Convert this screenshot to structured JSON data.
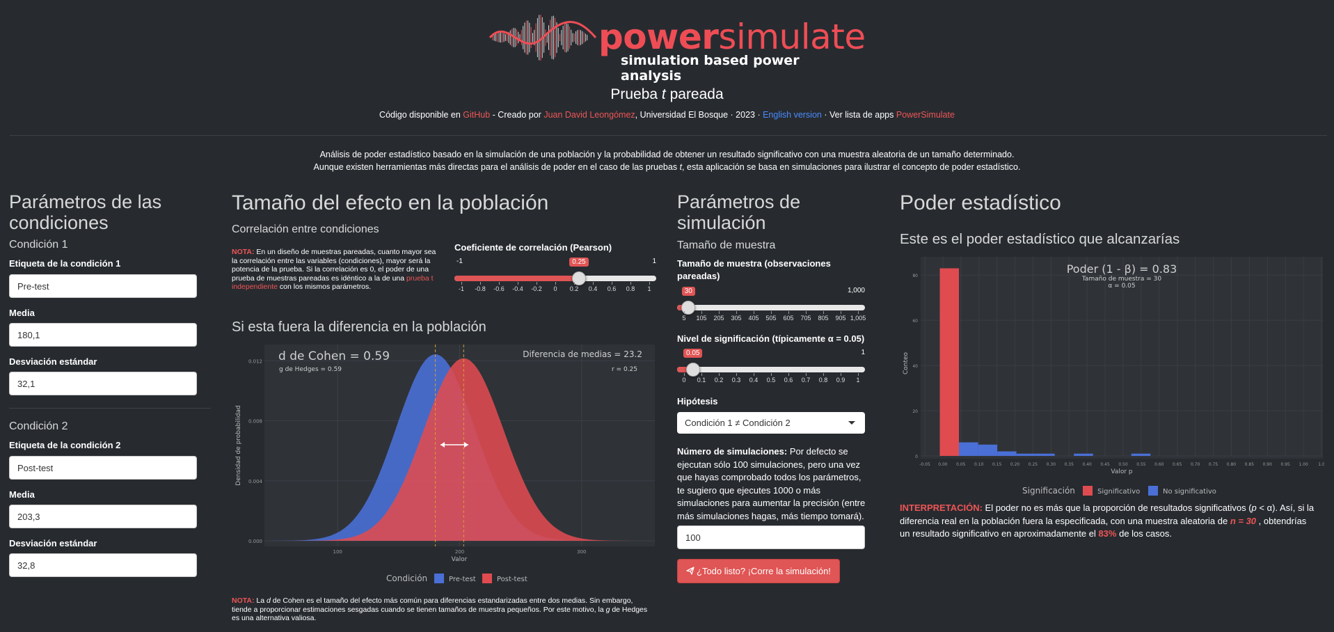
{
  "header": {
    "brand_part1": "power",
    "brand_part2": "simulate",
    "tagline": "simulation based power analysis",
    "title_pre": "Prueba ",
    "title_t": "t",
    "title_post": " pareada",
    "credits": {
      "code_available": "Código disponible en ",
      "github": "GitHub",
      "created_by": " - Creado por ",
      "author": "Juan David Leongómez",
      "affiliation": ", Universidad El Bosque · 2023 · ",
      "english": "English version",
      "apps_list": " · Ver lista de apps ",
      "powersimulate": "PowerSimulate"
    },
    "intro_line1": "Análisis de poder estadístico basado en la simulación de una población y la probabilidad de obtener un resultado significativo con una muestra aleatoria de un tamaño determinado.",
    "intro_line2_pre": "Aunque existen herramientas más directas para el análisis de poder en el caso de las pruebas ",
    "intro_line2_t": "t",
    "intro_line2_post": ", esta aplicación se basa en simulaciones para ilustrar el concepto de poder estadístico."
  },
  "conditions": {
    "heading": "Parámetros de las condiciones",
    "c1": {
      "title": "Condición 1",
      "label_label": "Etiqueta de la condición 1",
      "label_value": "Pre-test",
      "mean_label": "Media",
      "mean_value": "180,1",
      "sd_label": "Desviación estándar",
      "sd_value": "32,1"
    },
    "c2": {
      "title": "Condición 2",
      "label_label": "Etiqueta de la condición 2",
      "label_value": "Post-test",
      "mean_label": "Media",
      "mean_value": "203,3",
      "sd_label": "Desviación estándar",
      "sd_value": "32,8"
    }
  },
  "effect": {
    "heading": "Tamaño del efecto en la población",
    "corr_subheading": "Correlación entre condiciones",
    "note_label": "NOTA:",
    "note_text": " En un diseño de muestras pareadas, cuanto mayor sea la correlación entre las variables (condiciones), mayor será la potencia de la prueba. Si la correlación es 0, el poder de una prueba de muestras pareadas es idéntico a la de una ",
    "note_link": "prueba t independiente",
    "note_end": " con los mismos parámetros.",
    "corr_slider": {
      "label": "Coeficiente de correlación (Pearson)",
      "min": "-1",
      "max": "1",
      "value": "0.25",
      "value_num": 0.25,
      "ticks": [
        "-1",
        "-0.8",
        "-0.6",
        "-0.4",
        "-0.2",
        "0",
        "0.2",
        "0.4",
        "0.6",
        "0.8",
        "1"
      ]
    },
    "diff_heading": "Si esta fuera la diferencia en la población",
    "bottom_note_label": "NOTA:",
    "bottom_note_pre": " La ",
    "bottom_note_d": "d",
    "bottom_note_mid": " de Cohen es el tamaño del efecto más común para diferencias estandarizadas entre dos medias. Sin embargo, tiende a proporcionar estimaciones sesgadas cuando se tienen tamaños de muestra pequeños. Por este motivo, la ",
    "bottom_note_g": "g",
    "bottom_note_end": " de Hedges es una alternativa valiosa."
  },
  "density_chart": {
    "title": "d de Cohen = 0.59",
    "subtitle": "g de Hedges = 0.59",
    "right_title": "Diferencia de medias = 23.2",
    "right_subtitle": "r = 0.25",
    "ylabel": "Densidad de probabilidad",
    "xlabel": "Valor",
    "legend_title": "Condición",
    "colors": {
      "pre": "#4a6fd6",
      "post": "#e04b50"
    }
  },
  "simulation": {
    "heading": "Parámetros de simulación",
    "sample_subheading": "Tamaño de muestra",
    "n_slider": {
      "label": "Tamaño de muestra (observaciones pareadas)",
      "min": "5",
      "max": "1,000",
      "value": "30",
      "value_num": 30,
      "ticks": [
        "5",
        "105",
        "205",
        "305",
        "405",
        "505",
        "605",
        "705",
        "805",
        "905",
        "1,005"
      ]
    },
    "alpha_slider": {
      "label": "Nivel de significación (típicamente α = 0.05)",
      "min": "0",
      "max": "1",
      "value": "0.05",
      "value_num": 0.05,
      "ticks": [
        "0",
        "0.1",
        "0.2",
        "0.3",
        "0.4",
        "0.5",
        "0.6",
        "0.7",
        "0.8",
        "0.9",
        "1"
      ]
    },
    "hypothesis_label": "Hipótesis",
    "hypothesis_value": "Condición 1 ≠ Condición 2",
    "nsim_label": "Número de simulaciones:",
    "nsim_text": " Por defecto se ejecutan sólo 100 simulaciones, pero una vez que hayas comprobado todos los parámetros, te sugiero que ejecutes 1000 o más simulaciones para aumentar la precisión (entre más simulaciones hagas, más tiempo tomará).",
    "nsim_value": "100",
    "run_button": "¿Todo listo? ¡Corre la simulación!"
  },
  "power": {
    "heading": "Poder estadístico",
    "subheading": "Este es el poder estadístico que alcanzarías",
    "interpretation_label": "INTERPRETACIÓN:",
    "interp_1": " El poder no es más que la proporción de resultados significativos (",
    "interp_p": "p",
    "interp_2": " < α). Así, si la diferencia real en la población fuera la especificada, con una muestra aleatoria de ",
    "interp_n": "n = 30",
    "interp_3": " , obtendrías un resultado significativo en aproximadamente el ",
    "interp_pct": "83%",
    "interp_4": " de los casos."
  },
  "chart_data": {
    "type": "bar",
    "title": "Poder (1 - β) = 0.83",
    "subtitle1": "Tamaño de muestra = 30",
    "subtitle2": "α = 0.05",
    "xlabel": "Valor p",
    "ylabel": "Conteo",
    "xlim": [
      -0.05,
      1.0
    ],
    "ylim": [
      0,
      85
    ],
    "x_ticks": [
      "-0.05",
      "0.00",
      "0.05",
      "0.10",
      "0.15",
      "0.20",
      "0.25",
      "0.30",
      "0.35",
      "0.40",
      "0.45",
      "0.50",
      "0.55",
      "0.60",
      "0.65",
      "0.70",
      "0.75",
      "0.80",
      "0.85",
      "0.90",
      "0.95",
      "1.00",
      "1.0"
    ],
    "y_ticks": [
      "0",
      "20",
      "40",
      "60",
      "80"
    ],
    "legend_title": "Significación",
    "series": [
      {
        "name": "Significativo",
        "color": "#e04b50",
        "bins": [
          {
            "x0": 0.0,
            "x1": 0.05,
            "count": 83
          }
        ]
      },
      {
        "name": "No significativo",
        "color": "#4a6fd6",
        "bins": [
          {
            "x0": 0.05,
            "x1": 0.1,
            "count": 6
          },
          {
            "x0": 0.1,
            "x1": 0.15,
            "count": 5
          },
          {
            "x0": 0.15,
            "x1": 0.2,
            "count": 2
          },
          {
            "x0": 0.2,
            "x1": 0.25,
            "count": 1
          },
          {
            "x0": 0.25,
            "x1": 0.3,
            "count": 1
          },
          {
            "x0": 0.35,
            "x1": 0.4,
            "count": 1
          },
          {
            "x0": 0.5,
            "x1": 0.55,
            "count": 1
          }
        ]
      }
    ]
  }
}
